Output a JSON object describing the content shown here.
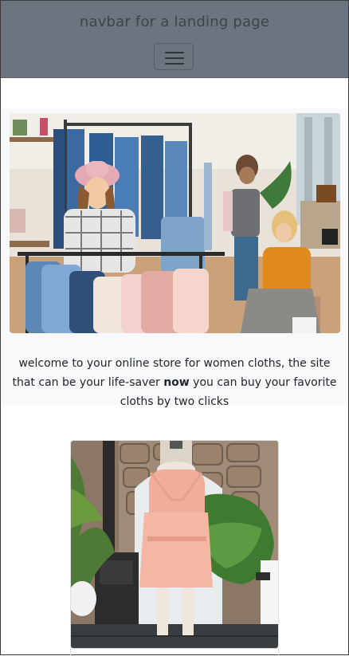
{
  "navbar": {
    "brand": "navbar for a landing page",
    "toggler_icon": "hamburger-menu-icon"
  },
  "hero": {
    "image": "store-shopping-photo",
    "text_before": "welcome to your online store for women cloths, the site that can be your life-saver ",
    "text_bold": "now",
    "text_after": " you can buy your favorite cloths by two clicks"
  },
  "product": {
    "image": "peach-dress-on-mannequin-photo"
  }
}
